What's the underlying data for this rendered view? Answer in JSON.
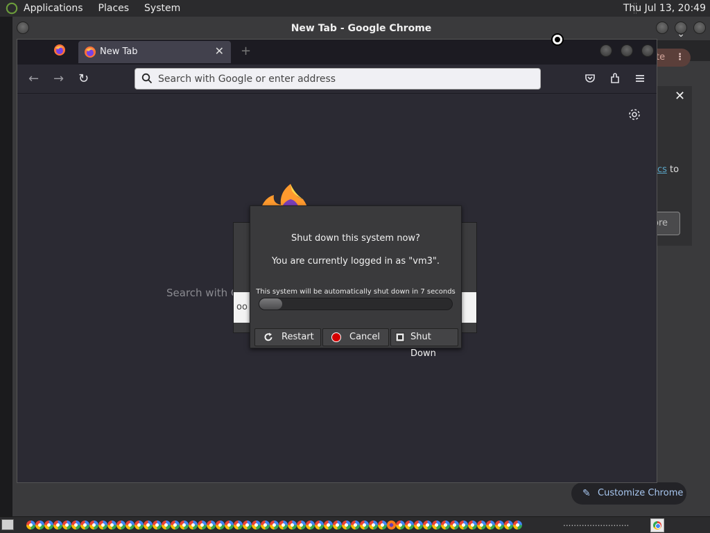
{
  "top_panel": {
    "menus": [
      "Applications",
      "Places",
      "System"
    ],
    "clock": "Thu Jul 13, 20:49"
  },
  "chrome_window": {
    "title": "New Tab - Google Chrome",
    "update_pill": "ate",
    "link_fragment": "cs",
    "link_suffix": " to",
    "more_button": "ore",
    "customize_label": "Customize Chrome"
  },
  "firefox": {
    "tab_label": "New Tab",
    "url_placeholder": "Search with Google or enter address",
    "search_dim": "Search with G"
  },
  "dialog_backdrop": {
    "text_fragment": "oo"
  },
  "shutdown_dialog": {
    "question": "Shut down this system now?",
    "logged_in": "You are currently logged in as \"vm3\".",
    "auto_text": "This system will be automatically shut down in 7 seconds",
    "progress_fraction": 0.12,
    "buttons": {
      "restart": "Restart",
      "cancel": "Cancel",
      "shutdown": "Shut Down"
    }
  },
  "taskbar": {
    "task_count": 55,
    "firefox_task_index": 40,
    "tail": "........................."
  }
}
